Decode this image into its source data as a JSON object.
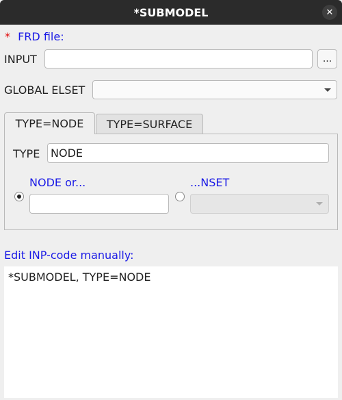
{
  "window": {
    "title": "*SUBMODEL",
    "close_symbol": "✕"
  },
  "frd": {
    "required_marker": "*",
    "label": "FRD file:"
  },
  "input": {
    "label": "INPUT",
    "value": "",
    "browse_label": "..."
  },
  "global_elset": {
    "label": "GLOBAL ELSET",
    "selected": ""
  },
  "tabs": [
    {
      "label": "TYPE=NODE",
      "active": true
    },
    {
      "label": "TYPE=SURFACE",
      "active": false
    }
  ],
  "type_field": {
    "label": "TYPE",
    "value": "NODE"
  },
  "node_option": {
    "label": "NODE or...",
    "checked": true,
    "value": ""
  },
  "nset_option": {
    "label": "...NSET",
    "checked": false,
    "selected": ""
  },
  "manual": {
    "label": "Edit INP-code manually:",
    "code": "*SUBMODEL, TYPE=NODE"
  }
}
